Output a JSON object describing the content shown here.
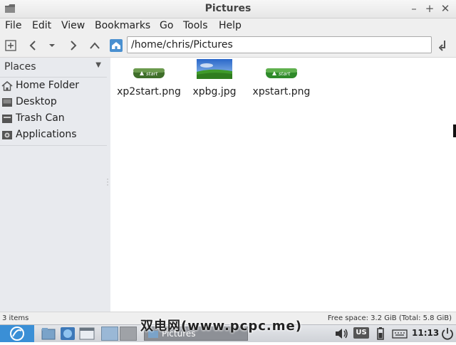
{
  "window": {
    "title": "Pictures"
  },
  "menu": [
    "File",
    "Edit",
    "View",
    "Bookmarks",
    "Go",
    "Tools",
    "Help"
  ],
  "toolbar": {
    "path": "/home/chris/Pictures"
  },
  "sidebar": {
    "header": "Places",
    "items": [
      {
        "label": "Home Folder",
        "icon": "home-icon"
      },
      {
        "label": "Desktop",
        "icon": "desktop-icon"
      },
      {
        "label": "Trash Can",
        "icon": "trash-icon"
      },
      {
        "label": "Applications",
        "icon": "applications-icon"
      }
    ]
  },
  "files": [
    {
      "name": "xp2start.png",
      "type": "start-button-image"
    },
    {
      "name": "xpbg.jpg",
      "type": "wallpaper-image"
    },
    {
      "name": "xpstart.png",
      "type": "start-button-image"
    }
  ],
  "thumb_text": "start",
  "status": {
    "count": "3 items",
    "free_space": "Free space: 3.2 GiB (Total: 5.8 GiB)"
  },
  "taskbar": {
    "task_label": "Pictures",
    "keyboard": "US",
    "clock": "11:13"
  },
  "watermark": "双电网(www.pcpc.me)",
  "colors": {
    "accent": "#3a8fd6",
    "sidebar_bg": "#e8eaee",
    "start_green": "#3f8f2a"
  }
}
